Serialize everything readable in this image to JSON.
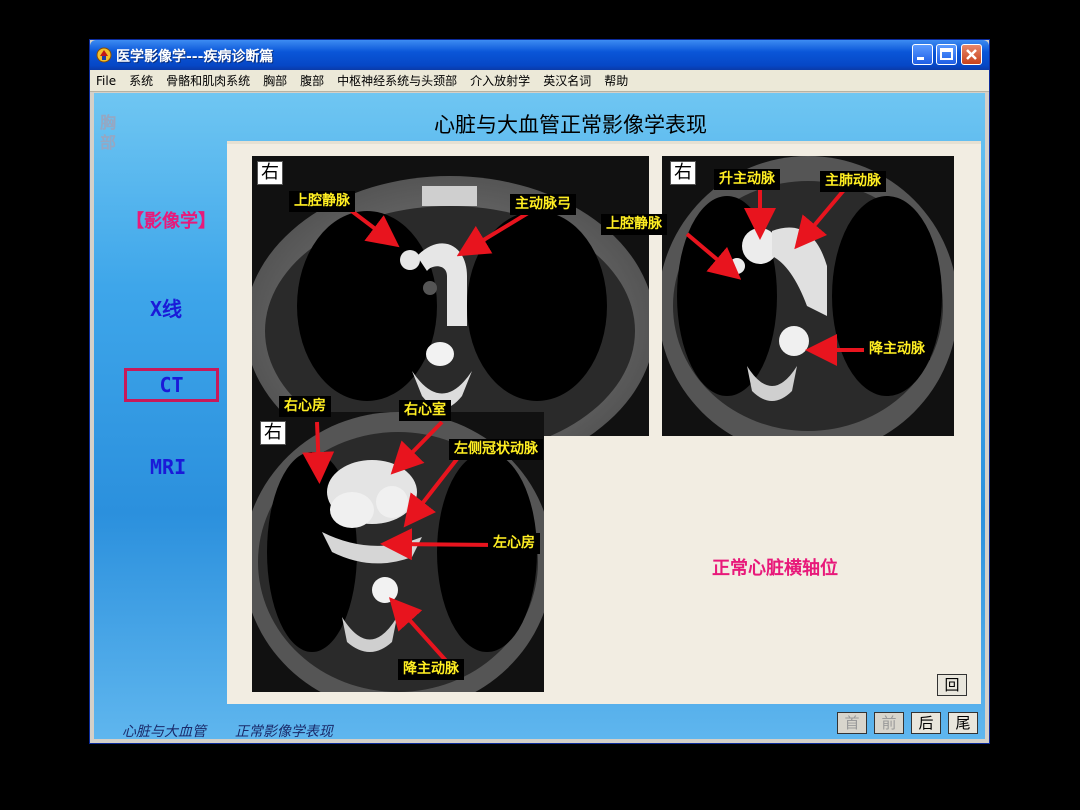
{
  "window": {
    "title": "医学影像学---疾病诊断篇",
    "icon": "app-icon"
  },
  "menu": [
    "File",
    "系统",
    "骨骼和肌肉系统",
    "胸部",
    "腹部",
    "中枢神经系统与头颈部",
    "介入放射学",
    "英汉名词",
    "帮助"
  ],
  "sidebar": {
    "section_title": "胸部",
    "section_heading": "【影像学】",
    "links": [
      "X线",
      "CT",
      "MRI"
    ],
    "active": "CT"
  },
  "page": {
    "title": "心脏与大血管正常影像学表现",
    "caption": "正常心脏横轴位"
  },
  "images": [
    {
      "orientation": "右",
      "labels": [
        "上腔静脉",
        "主动脉弓"
      ]
    },
    {
      "orientation": "右",
      "labels": [
        "升主动脉",
        "主肺动脉",
        "上腔静脉",
        "降主动脉"
      ]
    },
    {
      "orientation": "右",
      "labels": [
        "右心房",
        "右心室",
        "左侧冠状动脉",
        "左心房",
        "降主动脉"
      ]
    }
  ],
  "nav_buttons": {
    "back": "回",
    "first": "首",
    "prev": "前",
    "next": "后",
    "last": "尾"
  },
  "footer": {
    "chapter": "心脏与大血管",
    "topic": "正常影像学表现"
  },
  "colors": {
    "label_text": "#ffee22",
    "arrow": "#e8141e",
    "accent": "#e8197a",
    "link": "#1a1ad8"
  }
}
